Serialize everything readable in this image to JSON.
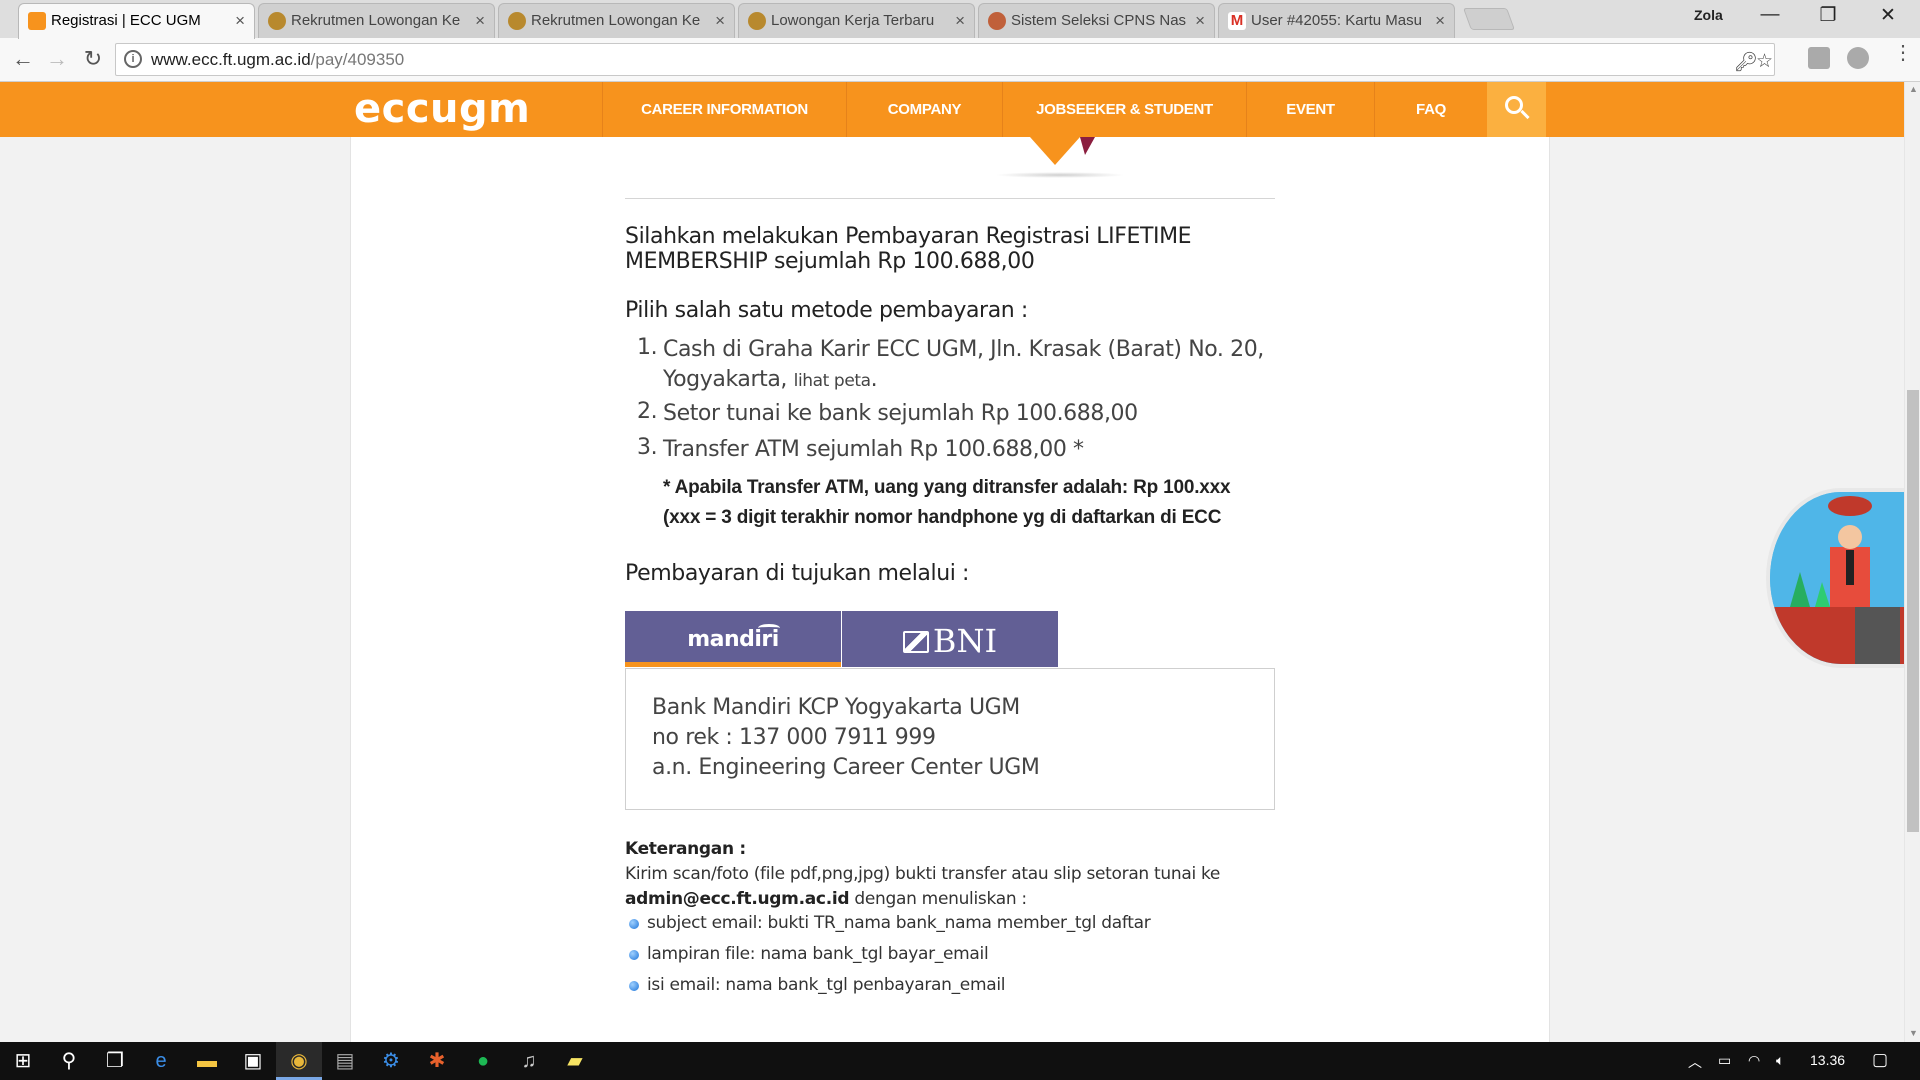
{
  "browser": {
    "tabs": [
      {
        "title": "Registrasi | ECC UGM",
        "active": true
      },
      {
        "title": "Rekrutmen Lowongan Ke",
        "active": false
      },
      {
        "title": "Rekrutmen Lowongan Ke",
        "active": false
      },
      {
        "title": "Lowongan Kerja Terbaru",
        "active": false
      },
      {
        "title": "Sistem Seleksi CPNS Nas",
        "active": false
      },
      {
        "title": "User #42055: Kartu Masu",
        "active": false
      }
    ],
    "profile_name": "Zola",
    "url_host": "www.ecc.ft.ugm.ac.id",
    "url_path": "/pay/409350"
  },
  "site": {
    "logo": "eccugm",
    "nav": [
      "CAREER INFORMATION",
      "COMPANY",
      "JOBSEEKER & STUDENT",
      "EVENT",
      "FAQ"
    ]
  },
  "page": {
    "lead": "Silahkan melakukan Pembayaran Registrasi LIFETIME MEMBERSHIP sejumlah Rp 100.688,00",
    "methods_heading": "Pilih salah satu metode pembayaran :",
    "methods": [
      {
        "num": "1.",
        "text": "Cash di Graha Karir ECC UGM, Jln. Krasak (Barat) No. 20, Yogyakarta,",
        "link": "lihat peta",
        "end": "."
      },
      {
        "num": "2.",
        "text": "Setor tunai ke bank sejumlah Rp 100.688,00"
      },
      {
        "num": "3.",
        "text": "Transfer ATM sejumlah Rp 100.688,00 *"
      }
    ],
    "note_line1": "* Apabila Transfer ATM, uang yang ditransfer adalah: Rp 100.xxx",
    "note_line2": "(xxx = 3 digit terakhir nomor handphone yg di daftarkan di ECC",
    "pay_heading": "Pembayaran di tujukan melalui :",
    "banks": [
      {
        "name": "mandiri",
        "active": true
      },
      {
        "name": "BNI",
        "active": false
      }
    ],
    "bank_details": [
      "Bank Mandiri KCP Yogyakarta UGM",
      "no rek : 137 000 7911 999",
      "a.n. Engineering Career Center UGM"
    ],
    "ket_title": "Keterangan :",
    "ket_text1": "Kirim scan/foto (file pdf,png,jpg) bukti transfer atau slip setoran tunai ke",
    "ket_email": "admin@ecc.ft.ugm.ac.id",
    "ket_text2": " dengan menuliskan :",
    "bullets": [
      "subject email: bukti TR_nama bank_nama member_tgl daftar",
      "lampiran file: nama bank_tgl bayar_email",
      "isi email: nama bank_tgl penbayaran_email"
    ]
  },
  "taskbar": {
    "clock": "13.36"
  },
  "colors": {
    "brand_orange": "#f7931d",
    "bank_tab_purple": "#625f95"
  }
}
